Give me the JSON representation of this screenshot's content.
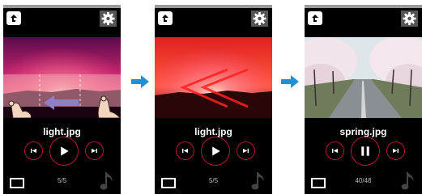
{
  "screens": [
    {
      "filename": "light.jpg",
      "counter": "5/5",
      "play_icon": "play-icon"
    },
    {
      "filename": "light.jpg",
      "counter": "5/5",
      "play_icon": "play-icon"
    },
    {
      "filename": "spring.jpg",
      "counter": "40/48",
      "play_icon": "pause-icon"
    }
  ],
  "icons": {
    "back": "back-icon",
    "settings": "gear-icon",
    "prev": "skip-previous-icon",
    "next": "skip-next-icon",
    "screen": "screen-mode-icon",
    "music": "music-note-icon",
    "transition": "arrow-right-icon"
  },
  "colors": {
    "accent": "#b01a36",
    "transition_arrow": "#1e90d6",
    "swipe_arrow": "#8f7ec8",
    "background": "#000000"
  }
}
